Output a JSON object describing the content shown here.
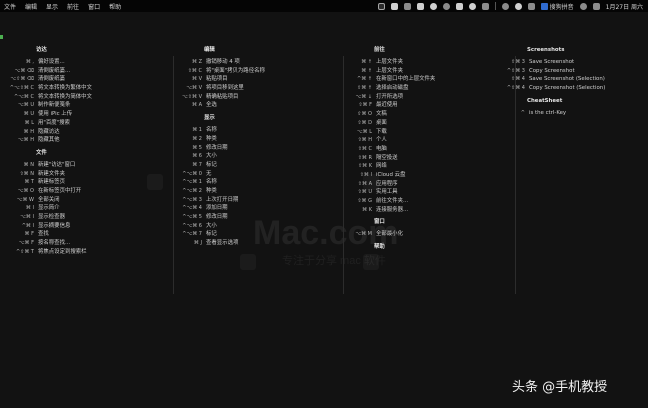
{
  "menubar": {
    "items": [
      "文件",
      "编辑",
      "显示",
      "前往",
      "窗口",
      "帮助"
    ],
    "ime_label": "搜狗拼音",
    "clock": "1月27日 周六"
  },
  "columns": [
    {
      "sections": [
        {
          "title": "访达",
          "rows": [
            {
              "shortcut": "⌘ ,",
              "label": "偏好设置..."
            },
            {
              "shortcut": "⌥⌘ ⌫",
              "label": "清倒废纸篓..."
            },
            {
              "shortcut": "⌥⇧⌘ ⌫",
              "label": "清倒废纸篓"
            },
            {
              "shortcut": "^⌥⇧⌘ C",
              "label": "将文本转换为繁体中文"
            },
            {
              "shortcut": "^⌥⌘ C",
              "label": "将文本转换为简体中文"
            },
            {
              "shortcut": "⌥⌘ U",
              "label": "制作新便笺条"
            },
            {
              "shortcut": "⌘ U",
              "label": "使用 iPic 上传"
            },
            {
              "shortcut": "⌘ L",
              "label": "用\"百度\"搜索"
            },
            {
              "shortcut": "⌘ H",
              "label": "隐藏访达"
            },
            {
              "shortcut": "⌥⌘ H",
              "label": "隐藏其他"
            }
          ]
        },
        {
          "title": "文件",
          "rows": [
            {
              "shortcut": "⌘ N",
              "label": "新建\"访达\"窗口"
            },
            {
              "shortcut": "⇧⌘ N",
              "label": "新建文件夹"
            },
            {
              "shortcut": "⌘ T",
              "label": "新建标签页"
            },
            {
              "shortcut": "⌥⌘ O",
              "label": "在新标签页中打开"
            },
            {
              "shortcut": "⌥⌘ W",
              "label": "全部关闭"
            },
            {
              "shortcut": "⌘ I",
              "label": "显示简介"
            },
            {
              "shortcut": "⌥⌘ I",
              "label": "显示检查器"
            },
            {
              "shortcut": "^⌘ I",
              "label": "显示摘要信息"
            },
            {
              "shortcut": "⌘ F",
              "label": "查找"
            },
            {
              "shortcut": "⌥⌘ F",
              "label": "按名称查找..."
            },
            {
              "shortcut": "^⇧⌘ T",
              "label": "将焦点设定到搜索栏"
            }
          ]
        }
      ]
    },
    {
      "sections": [
        {
          "title": "编辑",
          "rows": [
            {
              "shortcut": "⌘ Z",
              "label": "撤销移动 4 项"
            },
            {
              "shortcut": "⇧⌘ C",
              "label": "将\"桌面\"拷贝为路径名称"
            },
            {
              "shortcut": "⌘ V",
              "label": "粘贴项目"
            },
            {
              "shortcut": "⌥⌘ V",
              "label": "将项目移到这里"
            },
            {
              "shortcut": "⌥⇧⌘ V",
              "label": "精确粘贴项目"
            },
            {
              "shortcut": "⌘ A",
              "label": "全选"
            }
          ]
        },
        {
          "title": "显示",
          "rows": [
            {
              "shortcut": "⌘ 1",
              "label": "名称"
            },
            {
              "shortcut": "⌘ 2",
              "label": "种类"
            },
            {
              "shortcut": "⌘ 5",
              "label": "修改日期"
            },
            {
              "shortcut": "⌘ 6",
              "label": "大小"
            },
            {
              "shortcut": "⌘ 7",
              "label": "标记"
            },
            {
              "shortcut": "^⌥⌘ 0",
              "label": "无"
            },
            {
              "shortcut": "^⌥⌘ 1",
              "label": "名称"
            },
            {
              "shortcut": "^⌥⌘ 2",
              "label": "种类"
            },
            {
              "shortcut": "^⌥⌘ 3",
              "label": "上次打开日期"
            },
            {
              "shortcut": "^⌥⌘ 4",
              "label": "添加日期"
            },
            {
              "shortcut": "^⌥⌘ 5",
              "label": "修改日期"
            },
            {
              "shortcut": "^⌥⌘ 6",
              "label": "大小"
            },
            {
              "shortcut": "^⌥⌘ 7",
              "label": "标记"
            },
            {
              "shortcut": "⌘ J",
              "label": "查看显示选项"
            }
          ]
        }
      ]
    },
    {
      "sections": [
        {
          "title": "前往",
          "rows": [
            {
              "shortcut": "⌘ ↑",
              "label": "上层文件夹"
            },
            {
              "shortcut": "⌘ ↑",
              "label": "上层文件夹"
            },
            {
              "shortcut": "^⌘ ↑",
              "label": "在新窗口中的上层文件夹"
            },
            {
              "shortcut": "⇧⌘ ↑",
              "label": "选择启动磁盘"
            },
            {
              "shortcut": "⌥⌘ ↓",
              "label": "打开所选项"
            },
            {
              "shortcut": "⇧⌘ F",
              "label": "最近使用"
            },
            {
              "shortcut": "⇧⌘ O",
              "label": "文稿"
            },
            {
              "shortcut": "⇧⌘ D",
              "label": "桌面"
            },
            {
              "shortcut": "⌥⌘ L",
              "label": "下载"
            },
            {
              "shortcut": "⇧⌘ H",
              "label": "个人"
            },
            {
              "shortcut": "⇧⌘ C",
              "label": "电脑"
            },
            {
              "shortcut": "⇧⌘ R",
              "label": "隔空投送"
            },
            {
              "shortcut": "⇧⌘ K",
              "label": "网络"
            },
            {
              "shortcut": "⇧⌘ I",
              "label": "iCloud 云盘"
            },
            {
              "shortcut": "⇧⌘ A",
              "label": "应用程序"
            },
            {
              "shortcut": "⇧⌘ U",
              "label": "实用工具"
            },
            {
              "shortcut": "⇧⌘ G",
              "label": "前往文件夹..."
            },
            {
              "shortcut": "⌘ K",
              "label": "连接服务器..."
            }
          ]
        },
        {
          "title": "窗口",
          "rows": [
            {
              "shortcut": "⌥⌘ M",
              "label": "全部最小化"
            }
          ]
        },
        {
          "title": "帮助",
          "rows": []
        }
      ]
    },
    {
      "sections": [
        {
          "title": "Screenshots",
          "rows": [
            {
              "shortcut": "⇧⌘ 3",
              "label": "Save Screenshot"
            },
            {
              "shortcut": "^⇧⌘ 3",
              "label": "Copy Screenshot"
            },
            {
              "shortcut": "⇧⌘ 4",
              "label": "Save Screenshot (Selection)"
            },
            {
              "shortcut": "^⇧⌘ 4",
              "label": "Copy Screenshot (Selection)"
            }
          ]
        },
        {
          "title": "CheatSheet",
          "rows": [
            {
              "shortcut": "^",
              "label": "is the ctrl-Key"
            }
          ]
        }
      ]
    }
  ],
  "watermark": {
    "main": "Mac.com",
    "sub": "专注于分享 mac 软件"
  },
  "badge": {
    "text": "头条 @手机教授"
  },
  "colors": {
    "background": "#121212",
    "menubar": "#050505",
    "text": "#cfcfcf",
    "accent": "#4caf50"
  }
}
